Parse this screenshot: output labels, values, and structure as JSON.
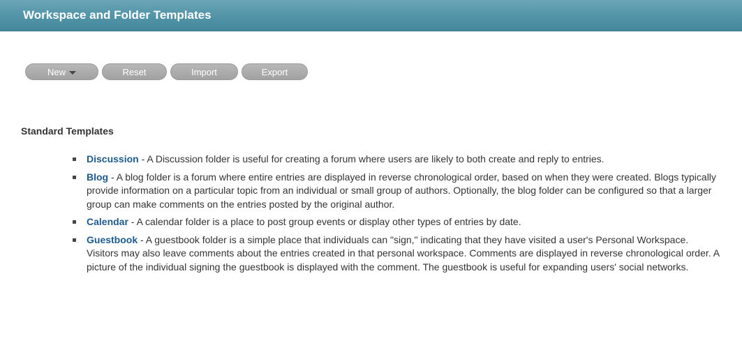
{
  "header": {
    "title": "Workspace and Folder Templates"
  },
  "toolbar": {
    "new_label": "New",
    "reset_label": "Reset",
    "import_label": "Import",
    "export_label": "Export"
  },
  "standard": {
    "title": "Standard Templates",
    "templates": [
      {
        "name": "Discussion",
        "description": " - A Discussion folder is useful for creating a forum where users are likely to both create and reply to entries."
      },
      {
        "name": "Blog",
        "description": " - A blog folder is a forum where entire entries are displayed in reverse chronological order, based on when they were created. Blogs typically provide information on a particular topic from an individual or small group of authors. Optionally, the blog folder can be configured so that a larger group can make comments on the entries posted by the original author."
      },
      {
        "name": "Calendar",
        "description": " - A calendar folder is a place to post group events or display other types of entries by date."
      },
      {
        "name": "Guestbook",
        "description": " - A guestbook folder is a simple place that individuals can \"sign,\" indicating that they have visited a user's Personal Workspace. Visitors may also leave comments about the entries created in that personal workspace. Comments are displayed in reverse chronological order. A picture of the individual signing the guestbook is displayed with the comment. The guestbook is useful for expanding users' social networks."
      }
    ]
  },
  "colors": {
    "header_bg": "#5495a8",
    "link": "#1e5b8c",
    "button_bg": "#a9a9a9"
  },
  "icons": {
    "new_dropdown": "caret-down-icon",
    "bullet": "square-bullet-icon"
  }
}
